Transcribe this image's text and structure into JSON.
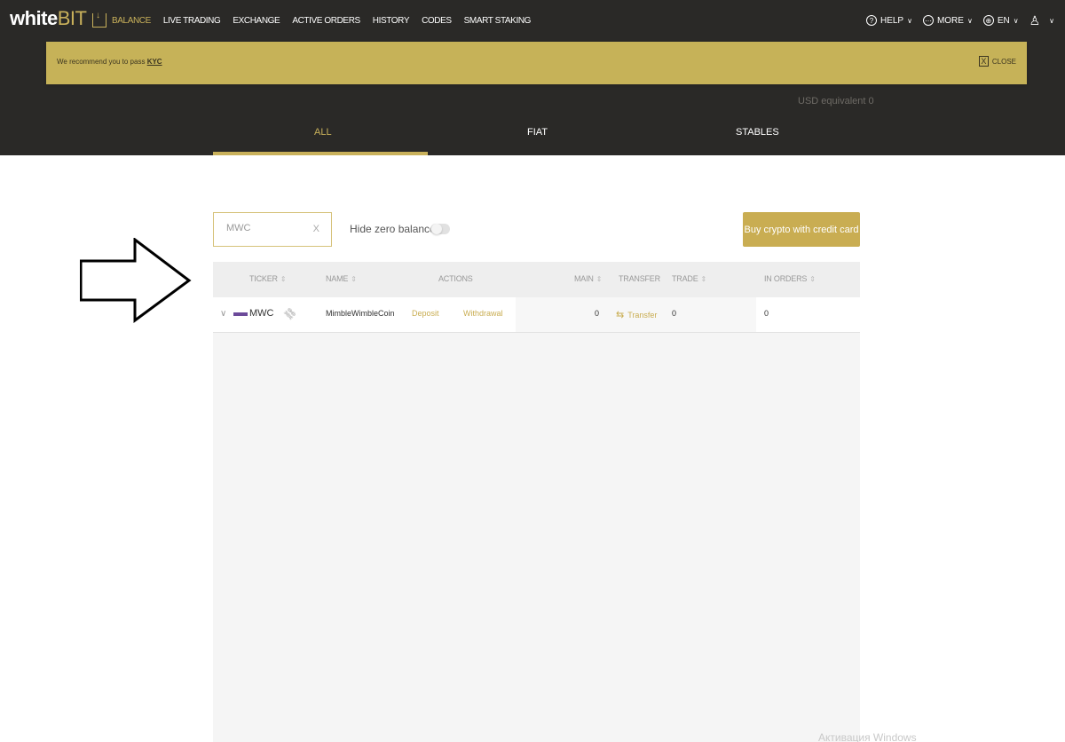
{
  "topbar": {
    "logo": {
      "white": "white",
      "bit": "BIT"
    },
    "nav": [
      {
        "label": "BALANCE",
        "active": true
      },
      {
        "label": "LIVE TRADING"
      },
      {
        "label": "EXCHANGE"
      },
      {
        "label": "ACTIVE ORDERS"
      },
      {
        "label": "HISTORY"
      },
      {
        "label": "CODES"
      },
      {
        "label": "SMART STAKING"
      }
    ],
    "right": {
      "help": "HELP",
      "more": "MORE",
      "lang": "EN"
    }
  },
  "banner": {
    "text": "We recommend you to pass",
    "link": "KYC",
    "close": "CLOSE"
  },
  "hero": {
    "usd_equivalent": "USD equivalent 0",
    "tabs": [
      {
        "label": "ALL",
        "active": true
      },
      {
        "label": "FIAT"
      },
      {
        "label": "STABLES"
      }
    ]
  },
  "controls": {
    "search_value": "MWC",
    "hide_zero_label": "Hide zero balances",
    "buy_label": "Buy crypto with credit card"
  },
  "table": {
    "headers": {
      "ticker": "TICKER",
      "name": "NAME",
      "actions": "ACTIONS",
      "main": "MAIN",
      "transfer": "TRANSFER",
      "trade": "TRADE",
      "in_orders": "IN ORDERS"
    },
    "rows": [
      {
        "ticker": "MWC",
        "name": "MimbleWimbleCoin",
        "deposit": "Deposit",
        "withdrawal": "Withdrawal",
        "main": "0",
        "transfer": "Transfer",
        "trade": "0",
        "in_orders": "0"
      }
    ]
  },
  "watermark": "Активация Windows",
  "colors": {
    "accent": "#c9ad52",
    "dark": "#2a2927",
    "banner": "#c6b258"
  }
}
